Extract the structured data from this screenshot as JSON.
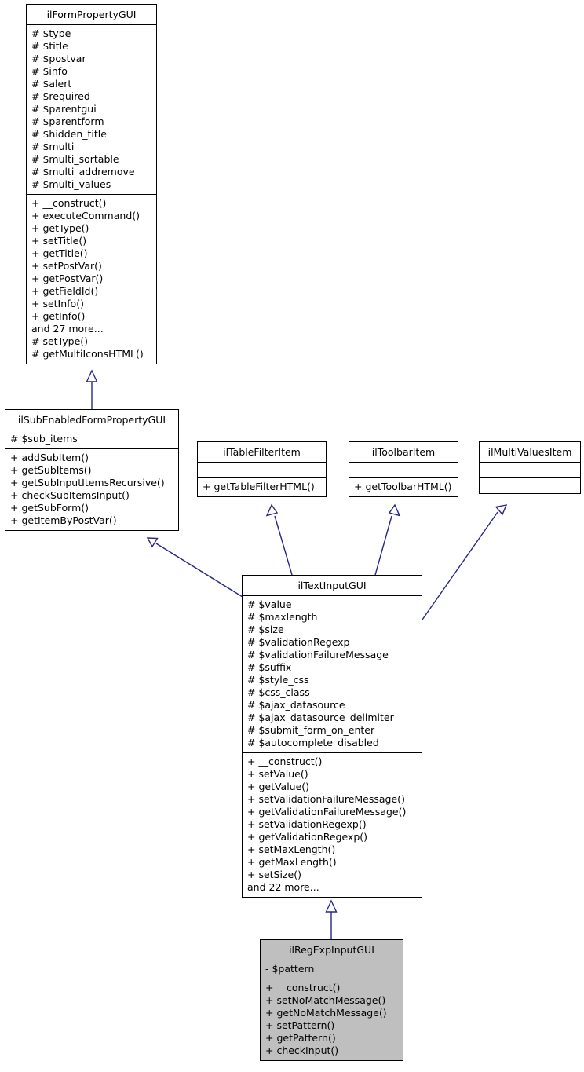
{
  "diagram": {
    "kind": "uml-class-inheritance-diagram",
    "accent_color": "#26268c",
    "highlight_fill": "#bfbfbf",
    "classes": [
      {
        "id": "ilFormPropertyGUI",
        "name": "ilFormPropertyGUI",
        "highlighted": false,
        "attributes": [
          "# $type",
          "# $title",
          "# $postvar",
          "# $info",
          "# $alert",
          "# $required",
          "# $parentgui",
          "# $parentform",
          "# $hidden_title",
          "# $multi",
          "# $multi_sortable",
          "# $multi_addremove",
          "# $multi_values"
        ],
        "methods": [
          "+ __construct()",
          "+ executeCommand()",
          "+ getType()",
          "+ setTitle()",
          "+ getTitle()",
          "+ setPostVar()",
          "+ getPostVar()",
          "+ getFieldId()",
          "+ setInfo()",
          "+ getInfo()",
          "and 27 more...",
          "# setType()",
          "# getMultiIconsHTML()"
        ]
      },
      {
        "id": "ilSubEnabledFormPropertyGUI",
        "name": "ilSubEnabledFormPropertyGUI",
        "highlighted": false,
        "attributes": [
          "# $sub_items"
        ],
        "methods": [
          "+ addSubItem()",
          "+ getSubItems()",
          "+ getSubInputItemsRecursive()",
          "+ checkSubItemsInput()",
          "+ getSubForm()",
          "+ getItemByPostVar()"
        ]
      },
      {
        "id": "ilTableFilterItem",
        "name": "ilTableFilterItem",
        "highlighted": false,
        "attributes": [],
        "methods": [
          "+ getTableFilterHTML()"
        ]
      },
      {
        "id": "ilToolbarItem",
        "name": "ilToolbarItem",
        "highlighted": false,
        "attributes": [],
        "methods": [
          "+ getToolbarHTML()"
        ]
      },
      {
        "id": "ilMultiValuesItem",
        "name": "ilMultiValuesItem",
        "highlighted": false,
        "attributes": [],
        "methods": []
      },
      {
        "id": "ilTextInputGUI",
        "name": "ilTextInputGUI",
        "highlighted": false,
        "attributes": [
          "# $value",
          "# $maxlength",
          "# $size",
          "# $validationRegexp",
          "# $validationFailureMessage",
          "# $suffix",
          "# $style_css",
          "# $css_class",
          "# $ajax_datasource",
          "# $ajax_datasource_delimiter",
          "# $submit_form_on_enter",
          "# $autocomplete_disabled"
        ],
        "methods": [
          "+ __construct()",
          "+ setValue()",
          "+ getValue()",
          "+ setValidationFailureMessage()",
          "+ getValidationFailureMessage()",
          "+ setValidationRegexp()",
          "+ getValidationRegexp()",
          "+ setMaxLength()",
          "+ getMaxLength()",
          "+ setSize()",
          "and 22 more..."
        ]
      },
      {
        "id": "ilRegExpInputGUI",
        "name": "ilRegExpInputGUI",
        "highlighted": true,
        "attributes": [
          "- $pattern"
        ],
        "methods": [
          "+ __construct()",
          "+ setNoMatchMessage()",
          "+ getNoMatchMessage()",
          "+ setPattern()",
          "+ getPattern()",
          "+ checkInput()"
        ]
      }
    ],
    "relations": [
      {
        "from": "ilSubEnabledFormPropertyGUI",
        "to": "ilFormPropertyGUI",
        "type": "inheritance"
      },
      {
        "from": "ilTextInputGUI",
        "to": "ilSubEnabledFormPropertyGUI",
        "type": "inheritance"
      },
      {
        "from": "ilTextInputGUI",
        "to": "ilTableFilterItem",
        "type": "inheritance"
      },
      {
        "from": "ilTextInputGUI",
        "to": "ilToolbarItem",
        "type": "inheritance"
      },
      {
        "from": "ilTextInputGUI",
        "to": "ilMultiValuesItem",
        "type": "inheritance"
      },
      {
        "from": "ilRegExpInputGUI",
        "to": "ilTextInputGUI",
        "type": "inheritance"
      }
    ]
  }
}
